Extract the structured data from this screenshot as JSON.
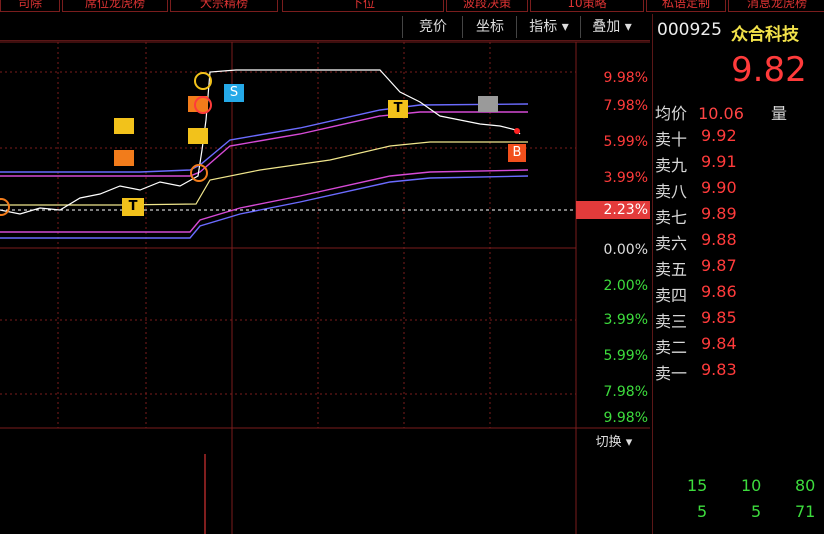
{
  "top_tabs": [
    "司除",
    "席位龙虎榜",
    "大宗精榜",
    "下位",
    "波段决策",
    "10策略",
    "私语定制",
    "消息龙虎榜"
  ],
  "toolbar": {
    "buttons": [
      "竞价",
      "坐标",
      "指标 ▾",
      "叠加 ▾"
    ],
    "switch_label": "切换 ▾"
  },
  "y_axis_labels": [
    {
      "label": "9.98%",
      "color": "#ff3b3b"
    },
    {
      "label": "7.98%",
      "color": "#ff3b3b"
    },
    {
      "label": "5.99%",
      "color": "#ff3b3b"
    },
    {
      "label": "3.99%",
      "color": "#ff3b3b"
    },
    {
      "label": "2.23%",
      "color": "#ffffff"
    },
    {
      "label": "0.00%",
      "color": "#dddddd"
    },
    {
      "label": "2.00%",
      "color": "#3ddc3d"
    },
    {
      "label": "3.99%",
      "color": "#3ddc3d"
    },
    {
      "label": "5.99%",
      "color": "#3ddc3d"
    },
    {
      "label": "7.98%",
      "color": "#3ddc3d"
    },
    {
      "label": "9.98%",
      "color": "#3ddc3d"
    }
  ],
  "markers": [
    {
      "letter": "S",
      "color": "#25a9e8"
    },
    {
      "letter": "B",
      "color": "#f2501c"
    },
    {
      "letter": "T",
      "color": "#f2c21b"
    }
  ],
  "stock": {
    "code": "000925",
    "name": "众合科技",
    "price": "9.82",
    "avg_label": "均价",
    "avg_value": "10.06",
    "vol_label": "量"
  },
  "asks": [
    {
      "label": "卖十",
      "value": "9.92"
    },
    {
      "label": "卖九",
      "value": "9.91"
    },
    {
      "label": "卖八",
      "value": "9.90"
    },
    {
      "label": "卖七",
      "value": "9.89"
    },
    {
      "label": "卖六",
      "value": "9.88"
    },
    {
      "label": "卖五",
      "value": "9.87"
    },
    {
      "label": "卖四",
      "value": "9.86"
    },
    {
      "label": "卖三",
      "value": "9.85"
    },
    {
      "label": "卖二",
      "value": "9.84"
    },
    {
      "label": "卖一",
      "value": "9.83"
    }
  ],
  "bottom_numbers": [
    [
      "15",
      "10",
      "80"
    ],
    [
      "5",
      "5",
      "71"
    ]
  ]
}
